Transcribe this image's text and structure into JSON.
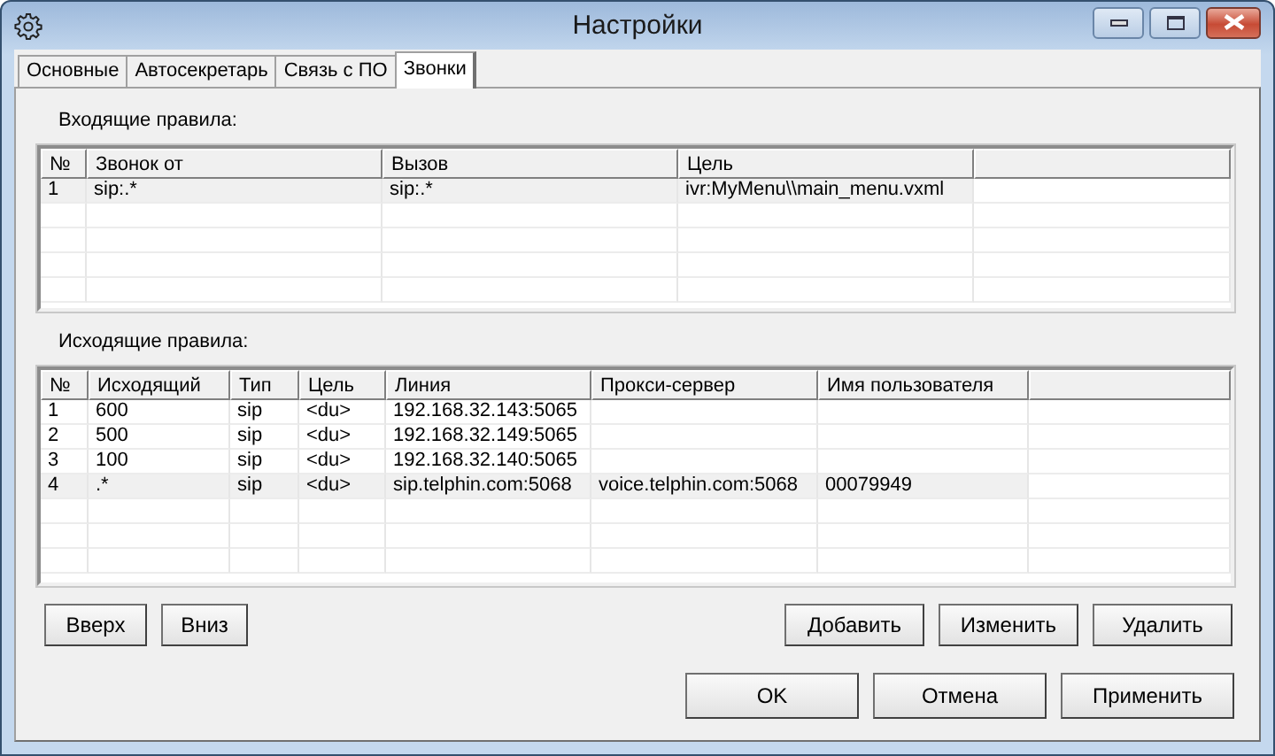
{
  "window": {
    "title": "Настройки"
  },
  "tabs": [
    {
      "label": "Основные",
      "selected": false
    },
    {
      "label": "Автосекретарь",
      "selected": false
    },
    {
      "label": "Связь с ПО",
      "selected": false
    },
    {
      "label": "Звонки",
      "selected": true
    }
  ],
  "incoming": {
    "label": "Входящие правила:",
    "columns": [
      "№",
      "Звонок от",
      "Вызов",
      "Цель"
    ],
    "rows": [
      {
        "cells": [
          "1",
          "sip:.*",
          "sip:.*",
          "ivr:MyMenu\\\\main_menu.vxml"
        ],
        "selected": true
      }
    ]
  },
  "outgoing": {
    "label": "Исходящие правила:",
    "columns": [
      "№",
      "Исходящий",
      "Тип",
      "Цель",
      "Линия",
      "Прокси-сервер",
      "Имя пользователя"
    ],
    "rows": [
      {
        "cells": [
          "1",
          "600",
          "sip",
          "<du>",
          "192.168.32.143:5065",
          "",
          ""
        ],
        "selected": false
      },
      {
        "cells": [
          "2",
          "500",
          "sip",
          "<du>",
          "192.168.32.149:5065",
          "",
          ""
        ],
        "selected": false
      },
      {
        "cells": [
          "3",
          "100",
          "sip",
          "<du>",
          "192.168.32.140:5065",
          "",
          ""
        ],
        "selected": false
      },
      {
        "cells": [
          "4",
          ".*",
          "sip",
          "<du>",
          "sip.telphin.com:5068",
          "voice.telphin.com:5068",
          "00079949"
        ],
        "selected": true
      }
    ]
  },
  "order_buttons": [
    "Вверх",
    "Вниз"
  ],
  "edit_buttons": [
    "Добавить",
    "Изменить",
    "Удалить"
  ],
  "dialog_buttons": [
    "OK",
    "Отмена",
    "Применить"
  ]
}
